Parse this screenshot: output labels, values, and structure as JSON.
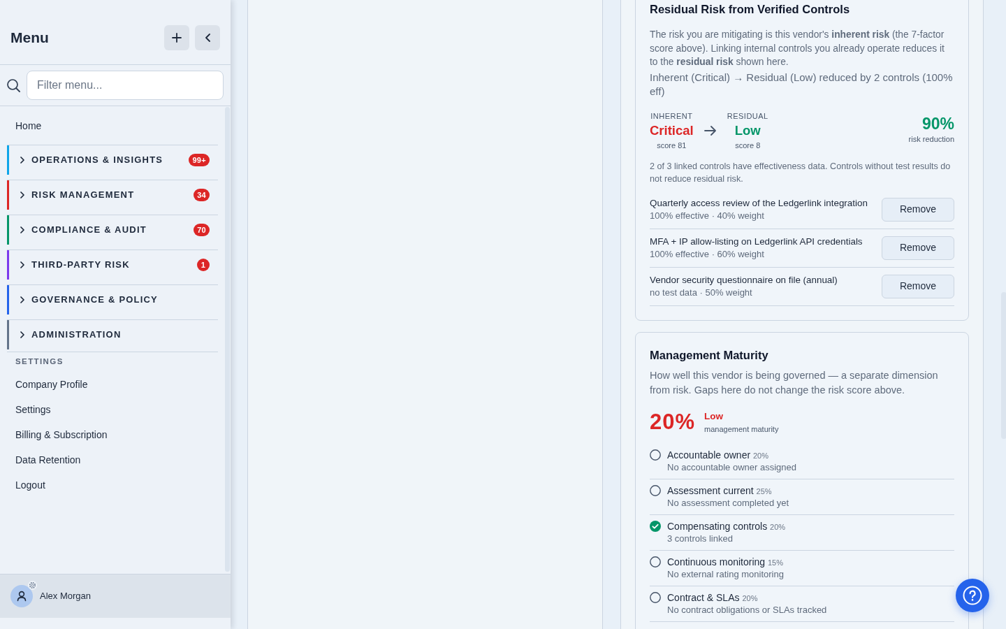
{
  "sidebar": {
    "title": "Menu",
    "filter": {
      "placeholder": "Filter menu..."
    },
    "items": [
      {
        "label": "Home"
      }
    ],
    "sections": [
      {
        "label": "OPERATIONS & INSIGHTS",
        "color": "#0ea5e9",
        "badge": "99+",
        "expanded": false
      },
      {
        "label": "RISK MANAGEMENT",
        "color": "#dc2626",
        "badge": "34",
        "expanded": false
      },
      {
        "label": "COMPLIANCE & AUDIT",
        "color": "#059669",
        "badge": "70",
        "expanded": false
      },
      {
        "label": "THIRD-PARTY RISK",
        "color": "#7c3aed",
        "badge": "1",
        "expanded": false
      },
      {
        "label": "GOVERNANCE & POLICY",
        "color": "#2563eb",
        "expanded": false
      },
      {
        "label": "ADMINISTRATION",
        "color": "#64748b",
        "expanded": false
      }
    ],
    "settings_heading": "SETTINGS",
    "settings_items": [
      {
        "label": "Company Profile"
      },
      {
        "label": "Settings"
      },
      {
        "label": "Billing & Subscription"
      },
      {
        "label": "Data Retention"
      },
      {
        "label": "Logout"
      }
    ],
    "user": {
      "name": "Alex Morgan"
    }
  },
  "residual_risk": {
    "title": "Residual Risk from Verified Controls",
    "description": "The risk you are mitigating is this vendor's **inherent risk** (the 7-factor score above). Linking internal controls you already operate reduces it to the **residual risk** shown here.",
    "summary": "Inherent (Critical) → Residual (Low) reduced by 2 controls (100% eff)",
    "levels": [
      {
        "label": "INHERENT",
        "rating": "Critical",
        "score": "score 81",
        "color": "#dc2626"
      },
      {
        "label": "RESIDUAL",
        "rating": "Low",
        "score": "score 8",
        "color": "#059669"
      }
    ],
    "reduction": {
      "value": "90%",
      "label": "risk reduction"
    },
    "note": "2 of 3 linked controls have effectiveness data. Controls without test results do not reduce residual risk.",
    "controls": [
      {
        "name": "Quarterly access review of the Ledgerlink integration",
        "detail": "100% effective · 40% weight",
        "action": "Remove"
      },
      {
        "name": "MFA + IP allow-listing on Ledgerlink API credentials",
        "detail": "100% effective · 60% weight",
        "action": "Remove"
      },
      {
        "name": "Vendor security questionnaire on file (annual)",
        "detail": "no test data · 50% weight",
        "action": "Remove"
      }
    ]
  },
  "maturity": {
    "title": "Management Maturity",
    "description": "How well this vendor is being governed — a separate dimension from risk. Gaps here do not change the risk score above.",
    "score": "20%",
    "rating": "Low",
    "color": "#dc2626",
    "caption": "management maturity",
    "factors": [
      {
        "name": "Accountable owner",
        "weight": "20%",
        "detail": "No accountable owner assigned",
        "checked": false
      },
      {
        "name": "Assessment current",
        "weight": "25%",
        "detail": "No assessment completed yet",
        "checked": false
      },
      {
        "name": "Compensating controls",
        "weight": "20%",
        "detail": "3 controls linked",
        "checked": true
      },
      {
        "name": "Continuous monitoring",
        "weight": "15%",
        "detail": "No external rating monitoring",
        "checked": false
      },
      {
        "name": "Contract & SLAs",
        "weight": "20%",
        "detail": "No contract obligations or SLAs tracked",
        "checked": false
      }
    ]
  }
}
